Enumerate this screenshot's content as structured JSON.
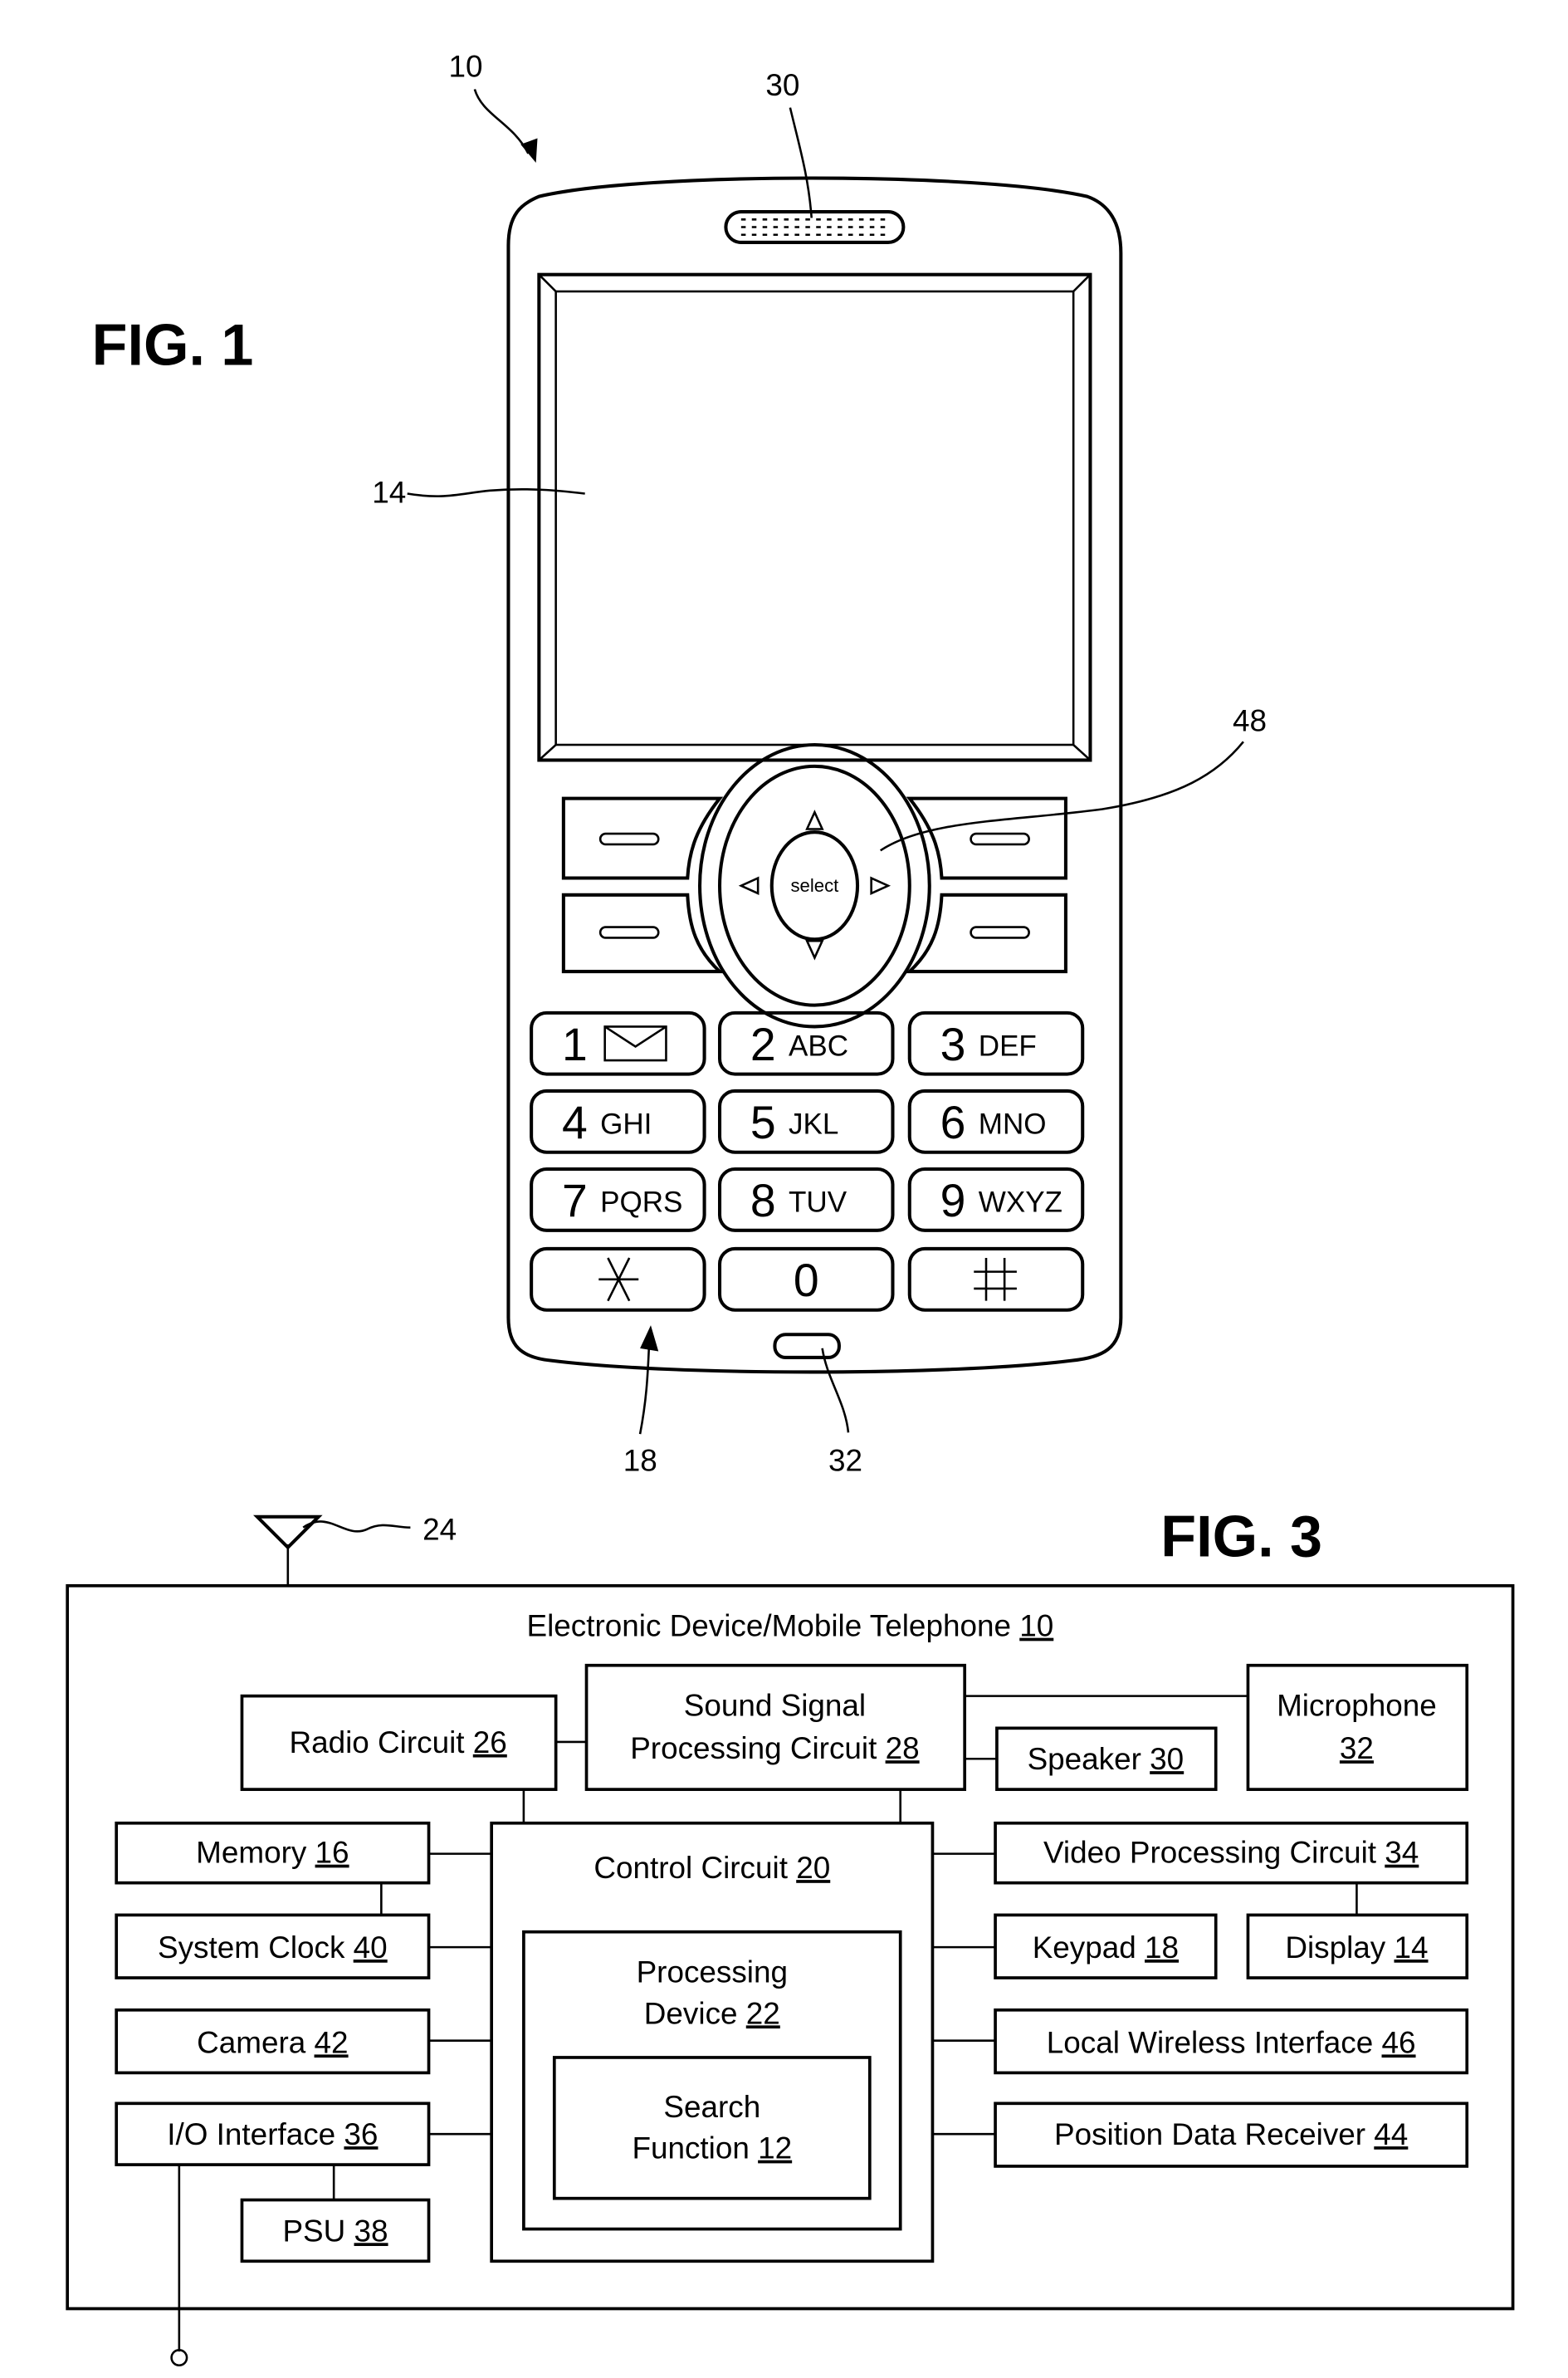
{
  "fig1": {
    "title": "FIG. 1",
    "refs": {
      "device": "10",
      "speaker": "30",
      "display": "14",
      "nav_key": "48",
      "keypad": "18",
      "microphone": "32"
    },
    "select_label": "select",
    "keys": [
      {
        "num": "1",
        "letters": "",
        "icon": "envelope-icon"
      },
      {
        "num": "2",
        "letters": "ABC"
      },
      {
        "num": "3",
        "letters": "DEF"
      },
      {
        "num": "4",
        "letters": "GHI"
      },
      {
        "num": "5",
        "letters": "JKL"
      },
      {
        "num": "6",
        "letters": "MNO"
      },
      {
        "num": "7",
        "letters": "PQRS"
      },
      {
        "num": "8",
        "letters": "TUV"
      },
      {
        "num": "9",
        "letters": "WXYZ"
      },
      {
        "num": "*",
        "letters": ""
      },
      {
        "num": "0",
        "letters": ""
      },
      {
        "num": "#",
        "letters": ""
      }
    ]
  },
  "fig3": {
    "title": "FIG. 3",
    "antenna_ref": "24",
    "container": {
      "label": "Electronic Device/Mobile Telephone",
      "ref": "10"
    },
    "blocks": {
      "radio": {
        "label": "Radio Circuit",
        "ref": "26"
      },
      "sound_line1": "Sound Signal",
      "sound_line2": "Processing Circuit",
      "sound_ref": "28",
      "microphone_line1": "Microphone",
      "microphone_ref": "32",
      "speaker": {
        "label": "Speaker",
        "ref": "30"
      },
      "memory": {
        "label": "Memory",
        "ref": "16"
      },
      "clock": {
        "label": "System Clock",
        "ref": "40"
      },
      "camera": {
        "label": "Camera",
        "ref": "42"
      },
      "io": {
        "label": "I/O Interface",
        "ref": "36"
      },
      "psu": {
        "label": "PSU",
        "ref": "38"
      },
      "control": {
        "label": "Control Circuit",
        "ref": "20"
      },
      "processing_line1": "Processing",
      "processing_line2": "Device",
      "processing_ref": "22",
      "search_line1": "Search",
      "search_line2": "Function",
      "search_ref": "12",
      "video": {
        "label": "Video Processing Circuit",
        "ref": "34"
      },
      "keypad": {
        "label": "Keypad",
        "ref": "18"
      },
      "display": {
        "label": "Display",
        "ref": "14"
      },
      "wireless": {
        "label": "Local Wireless Interface",
        "ref": "46"
      },
      "position": {
        "label": "Position Data Receiver",
        "ref": "44"
      }
    }
  }
}
